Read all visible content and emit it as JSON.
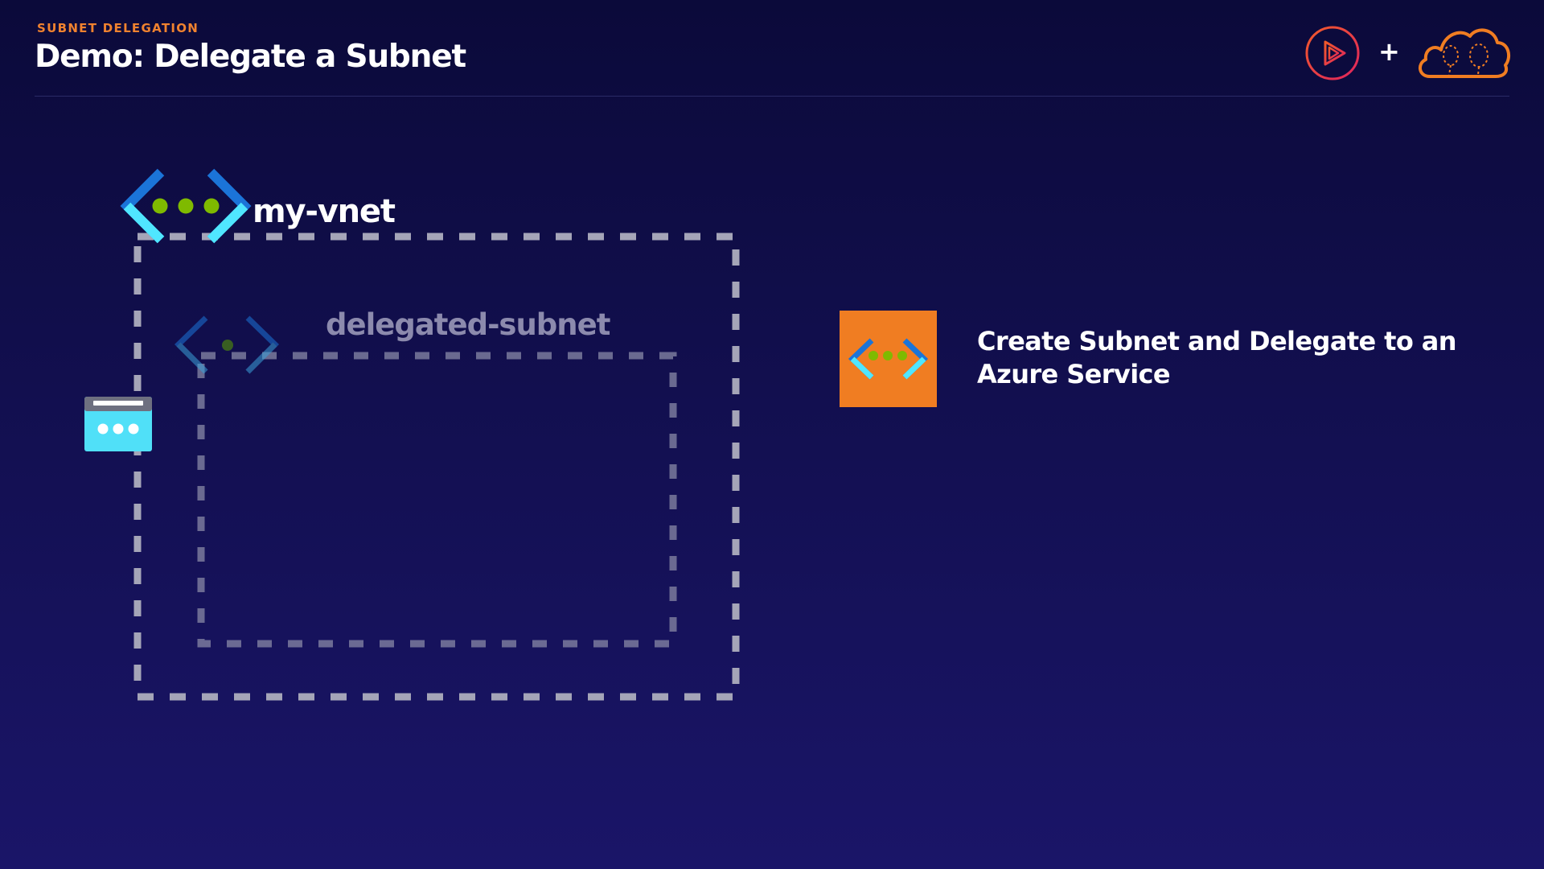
{
  "header": {
    "eyebrow": "SUBNET DELEGATION",
    "title": "Demo: Delegate a Subnet",
    "plus": "+"
  },
  "diagram": {
    "vnet_label": "my-vnet",
    "subnet_label": "delegated-subnet"
  },
  "step": {
    "text": "Create Subnet and Delegate to an Azure Service"
  },
  "colors": {
    "background": "#120f4f",
    "accent_orange": "#f07d22",
    "brand_pink": "#e0245e",
    "azure_blue": "#1b74d8",
    "azure_cyan": "#50e6ff",
    "green_dot": "#7fba00",
    "dashed_border": "#a5a5b8"
  },
  "icons": {
    "brand": "pluralsight-play-logo",
    "partner": "cloud-balloons-logo",
    "vnet": "virtual-network-icon",
    "subnet": "subnet-icon",
    "service": "azure-service-window-icon",
    "step": "virtual-network-step-icon"
  }
}
